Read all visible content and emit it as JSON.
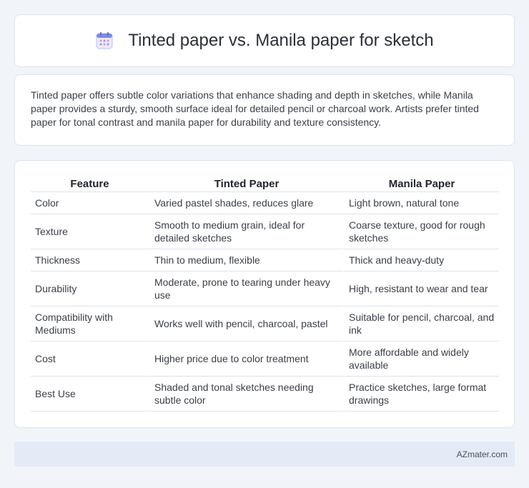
{
  "header": {
    "title": "Tinted paper vs. Manila paper for sketch",
    "icon": "calendar-icon"
  },
  "summary": {
    "text": "Tinted paper offers subtle color variations that enhance shading and depth in sketches, while Manila paper provides a sturdy, smooth surface ideal for detailed pencil or charcoal work. Artists prefer tinted paper for tonal contrast and manila paper for durability and texture consistency."
  },
  "table": {
    "headers": [
      "Feature",
      "Tinted Paper",
      "Manila Paper"
    ],
    "rows": [
      [
        "Color",
        "Varied pastel shades, reduces glare",
        "Light brown, natural tone"
      ],
      [
        "Texture",
        "Smooth to medium grain, ideal for detailed sketches",
        "Coarse texture, good for rough sketches"
      ],
      [
        "Thickness",
        "Thin to medium, flexible",
        "Thick and heavy-duty"
      ],
      [
        "Durability",
        "Moderate, prone to tearing under heavy use",
        "High, resistant to wear and tear"
      ],
      [
        "Compatibility with Mediums",
        "Works well with pencil, charcoal, pastel",
        "Suitable for pencil, charcoal, and ink"
      ],
      [
        "Cost",
        "Higher price due to color treatment",
        "More affordable and widely available"
      ],
      [
        "Best Use",
        "Shaded and tonal sketches needing subtle color",
        "Practice sketches, large format drawings"
      ]
    ]
  },
  "footer": {
    "brand": "AZmater.com"
  },
  "colors": {
    "background": "#f1f4f9",
    "card": "#ffffff",
    "footer_bg": "#e5ebf6",
    "icon_accent": "#7b8ce0"
  }
}
